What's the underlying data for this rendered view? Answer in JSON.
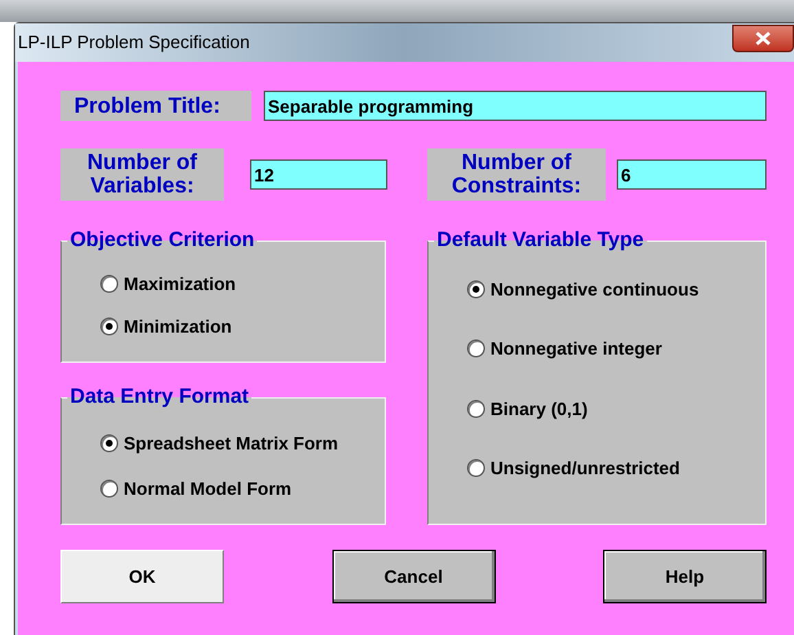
{
  "window": {
    "title": "LP-ILP Problem Specification"
  },
  "problem_title": {
    "label": "Problem Title:",
    "value": "Separable programming"
  },
  "variables": {
    "label": "Number of Variables:",
    "value": "12"
  },
  "constraints": {
    "label": "Number of Constraints:",
    "value": "6"
  },
  "groups": [
    {
      "title": "Objective Criterion",
      "options": [
        {
          "label": "Maximization",
          "selected": false
        },
        {
          "label": "Minimization",
          "selected": true
        }
      ]
    },
    {
      "title": "Data Entry Format",
      "options": [
        {
          "label": "Spreadsheet Matrix Form",
          "selected": true
        },
        {
          "label": "Normal Model Form",
          "selected": false
        }
      ]
    },
    {
      "title": "Default Variable Type",
      "options": [
        {
          "label": "Nonnegative continuous",
          "selected": true
        },
        {
          "label": "Nonnegative integer",
          "selected": false
        },
        {
          "label": "Binary (0,1)",
          "selected": false
        },
        {
          "label": "Unsigned/unrestricted",
          "selected": false
        }
      ]
    }
  ],
  "buttons": [
    {
      "label": "OK",
      "focused": true
    },
    {
      "label": "Cancel",
      "focused": false
    },
    {
      "label": "Help",
      "focused": false
    }
  ]
}
